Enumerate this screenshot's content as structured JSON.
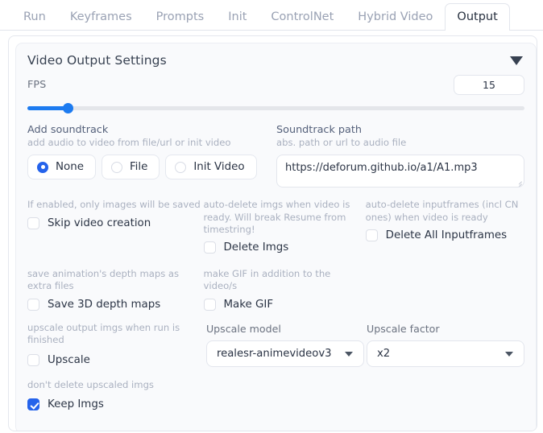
{
  "tabs": [
    {
      "label": "Run",
      "active": false
    },
    {
      "label": "Keyframes",
      "active": false
    },
    {
      "label": "Prompts",
      "active": false
    },
    {
      "label": "Init",
      "active": false
    },
    {
      "label": "ControlNet",
      "active": false
    },
    {
      "label": "Hybrid Video",
      "active": false
    },
    {
      "label": "Output",
      "active": true
    }
  ],
  "accordion": {
    "title": "Video Output Settings",
    "caret_icon": "chevron-down-icon"
  },
  "fps": {
    "label": "FPS",
    "value": "15",
    "slider_percent": 8.2
  },
  "soundtrack": {
    "label": "Add soundtrack",
    "hint": "add audio to video from file/url or init video",
    "options": [
      {
        "label": "None",
        "selected": true
      },
      {
        "label": "File",
        "selected": false
      },
      {
        "label": "Init Video",
        "selected": false
      }
    ]
  },
  "soundtrack_path": {
    "label": "Soundtrack path",
    "hint": "abs. path or url to audio file",
    "value": "https://deforum.github.io/a1/A1.mp3",
    "placeholder": "abs. path or url to audio file"
  },
  "skip_video": {
    "hint": "If enabled, only images will be saved",
    "label": "Skip video creation",
    "checked": false
  },
  "delete_imgs": {
    "hint": "auto-delete imgs when video is ready. Will break Resume from timestring!",
    "label": "Delete Imgs",
    "checked": false
  },
  "delete_all_inputframes": {
    "hint": "auto-delete inputframes (incl CN ones) when video is ready",
    "label": "Delete All Inputframes",
    "checked": false
  },
  "save_depth": {
    "hint": "save animation's depth maps as extra files",
    "label": "Save 3D depth maps",
    "checked": false
  },
  "make_gif": {
    "hint": "make GIF in addition to the video/s",
    "label": "Make GIF",
    "checked": false
  },
  "upscale": {
    "hint": "upscale output imgs when run is finished",
    "label": "Upscale",
    "checked": false
  },
  "upscale_model": {
    "label": "Upscale model",
    "value": "realesr-animevideov3",
    "caret_icon": "chevron-down-icon"
  },
  "upscale_factor": {
    "label": "Upscale factor",
    "value": "x2",
    "caret_icon": "chevron-down-icon"
  },
  "keep_imgs": {
    "hint": "don't delete upscaled imgs",
    "label": "Keep Imgs",
    "checked": true
  },
  "colors": {
    "accent": "#2563eb",
    "slider": "#1d7bf0",
    "text": "#2b3445",
    "muted": "#aab1c0",
    "panel_bg": "#f9fafc"
  }
}
